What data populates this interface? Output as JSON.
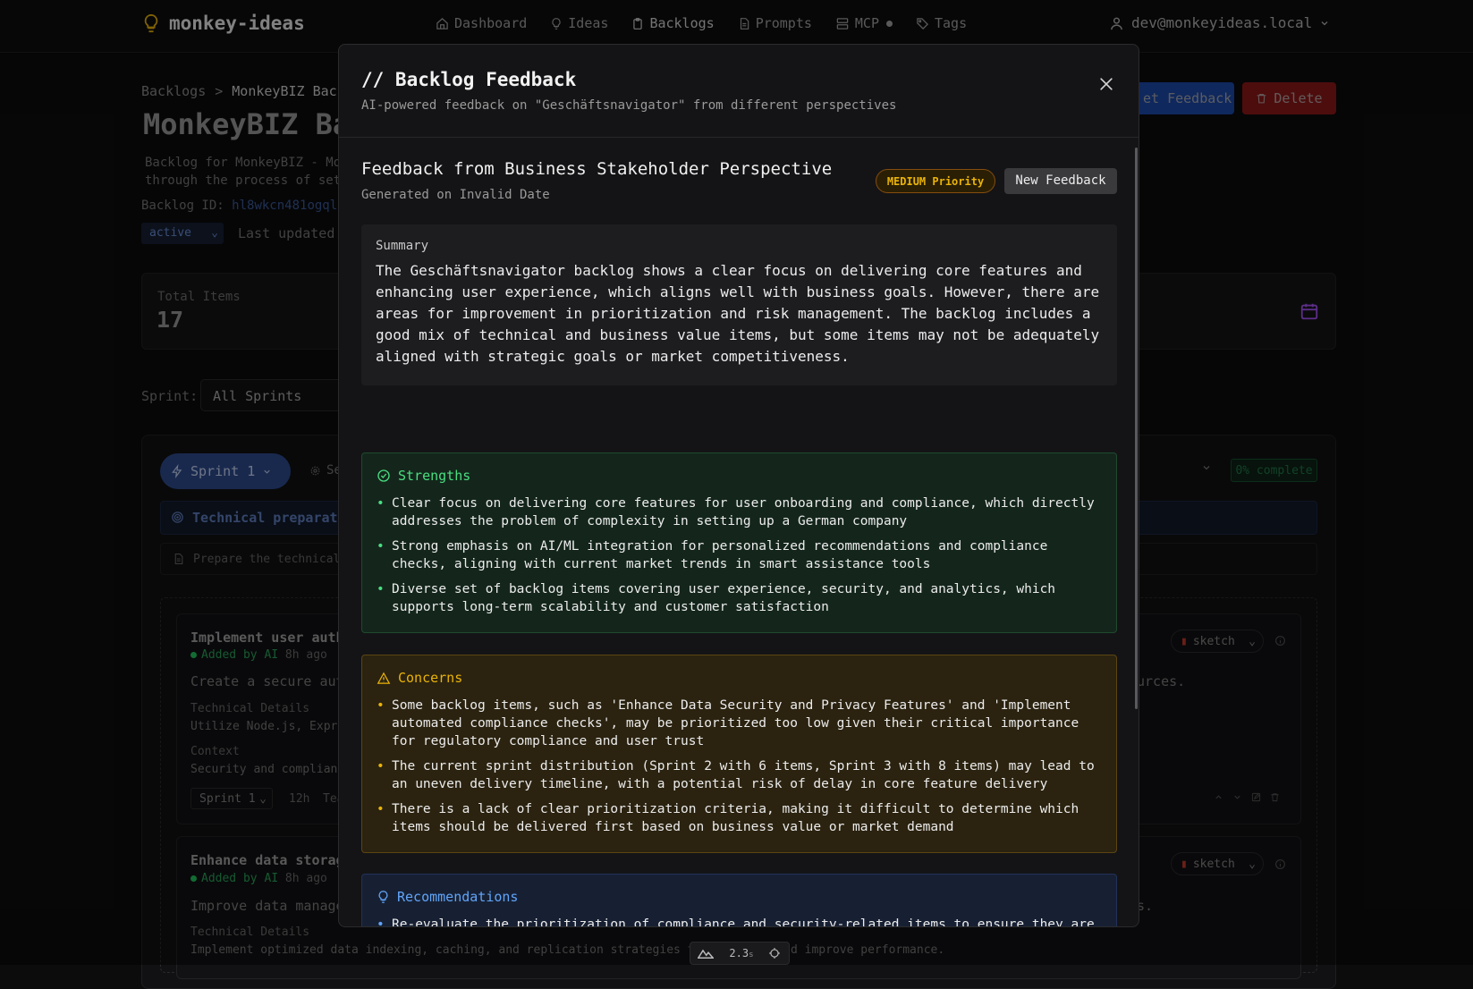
{
  "nav": {
    "logo": "monkey-ideas",
    "links": [
      {
        "label": "Dashboard",
        "icon": "home-icon"
      },
      {
        "label": "Ideas",
        "icon": "lightbulb-icon"
      },
      {
        "label": "Backlogs",
        "icon": "clipboard-icon"
      },
      {
        "label": "Prompts",
        "icon": "document-icon"
      },
      {
        "label": "MCP",
        "icon": "server-icon"
      },
      {
        "label": "Tags",
        "icon": "tag-icon"
      }
    ],
    "user": "dev@monkeyideas.local"
  },
  "page": {
    "breadcrumb_root": "Backlogs",
    "breadcrumb_sep": ">",
    "breadcrumb_current": "MonkeyBIZ Backl",
    "title": "MonkeyBIZ Ba",
    "desc_line1": "Backlog for MonkeyBIZ - Mo",
    "desc_line2": "through the process of set",
    "backlog_id_label": "Backlog ID:",
    "backlog_id_value": "hl8wkcn481ogql",
    "status": "active",
    "last_updated_label": "Last updated:",
    "total_items_label": "Total Items",
    "total_items_value": "17",
    "get_feedback_btn": "et Feedback",
    "delete_btn": "Delete",
    "sprint_label": "Sprint:",
    "sprint_filter": "All Sprints",
    "sprint_pill": "Sprint 1",
    "sprint_settings": "Se",
    "percent_complete": "0% complete",
    "technical_label": "Technical preparati",
    "prepare_text": "Prepare the technical s",
    "items": [
      {
        "title": "Implement user authe",
        "added_by": "Added by AI",
        "time": "8h ago",
        "desc": "Create a secure auth",
        "desc_tail": "urces.",
        "technical_label": "Technical Details",
        "technical_value": "Utilize Node.js, Expres",
        "context_label": "Context",
        "context_value": "Security and compliance",
        "sprint": "Sprint 1",
        "hours": "12h",
        "team": "Tea",
        "tag": "sketch"
      },
      {
        "title": "Enhance data storage",
        "added_by": "Added by AI",
        "time": "8h ago",
        "desc": "Improve data managem",
        "desc_tail": "s.",
        "technical_label": "Technical Details",
        "technical_value": "Implement optimized data indexing, caching, and replication strategies to min",
        "technical_tail": "d improve performance.",
        "tag": "sketch"
      }
    ]
  },
  "modal": {
    "title": "// Backlog Feedback",
    "subtitle": "AI-powered feedback on \"Geschäftsnavigator\" from different perspectives",
    "feedback_title": "Feedback from Business Stakeholder Perspective",
    "generated": "Generated on Invalid Date",
    "priority": "MEDIUM Priority",
    "new_feedback": "New Feedback",
    "summary_label": "Summary",
    "summary": "The Geschäftsnavigator backlog shows a clear focus on delivering core features and enhancing user experience, which aligns well with business goals. However, there are areas for improvement in prioritization and risk management. The backlog includes a good mix of technical and business value items, but some items may not be adequately aligned with strategic goals or market competitiveness.",
    "strengths_label": "Strengths",
    "strengths": [
      "Clear focus on delivering core features for user onboarding and compliance, which directly addresses the problem of complexity in setting up a German company",
      "Strong emphasis on AI/ML integration for personalized recommendations and compliance checks, aligning with current market trends in smart assistance tools",
      "Diverse set of backlog items covering user experience, security, and analytics, which supports long-term scalability and customer satisfaction"
    ],
    "concerns_label": "Concerns",
    "concerns": [
      "Some backlog items, such as 'Enhance Data Security and Privacy Features' and 'Implement automated compliance checks', may be prioritized too low given their critical importance for regulatory compliance and user trust",
      "The current sprint distribution (Sprint 2 with 6 items, Sprint 3 with 8 items) may lead to an uneven delivery timeline, with a potential risk of delay in core feature delivery",
      "There is a lack of clear prioritization criteria, making it difficult to determine which items should be delivered first based on business value or market demand"
    ],
    "recommendations_label": "Recommendations",
    "recommendations": [
      "Re-evaluate the prioritization of compliance and security-related items to ensure they are addressed earlier in the development cycle, especially given the regulatory environment in Germany"
    ],
    "bullet": "•"
  },
  "perf": {
    "value": "2.3",
    "unit": "s"
  }
}
